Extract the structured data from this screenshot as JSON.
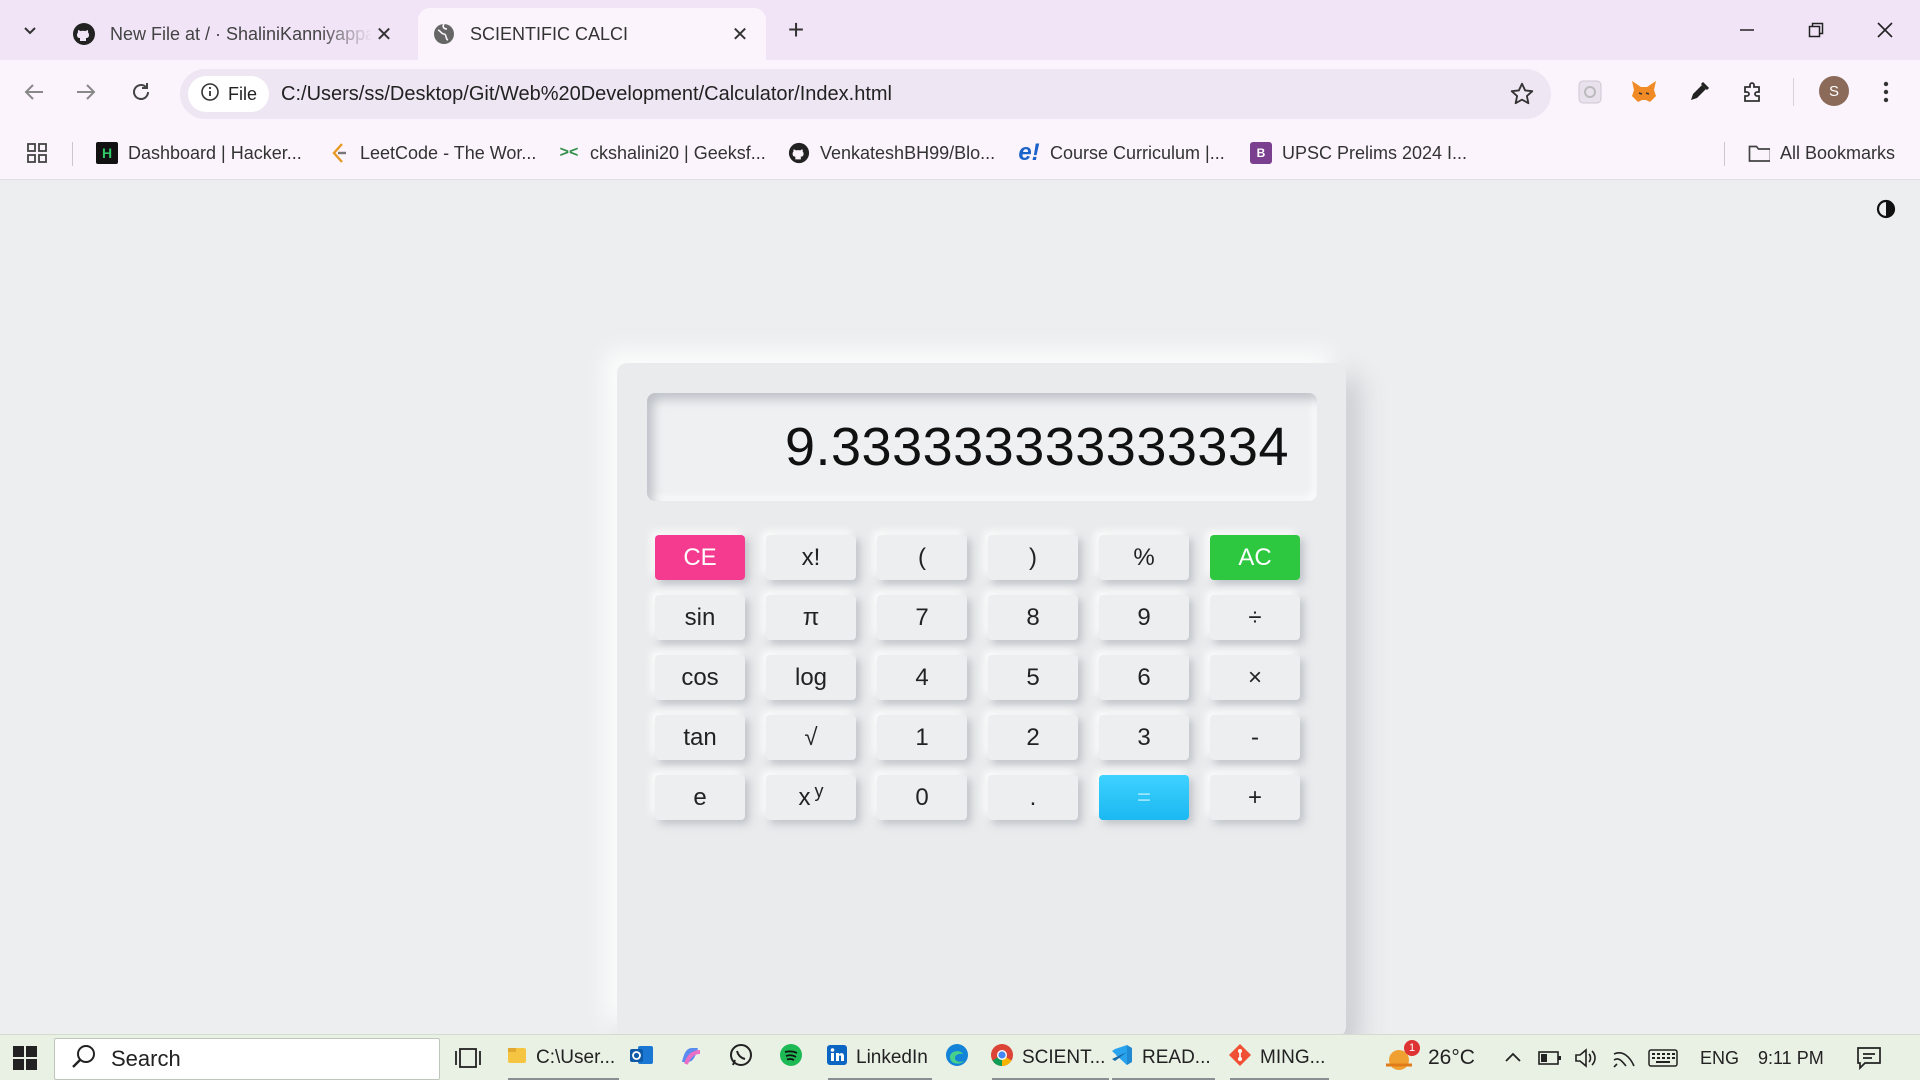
{
  "tabs": [
    {
      "title": "New File at / · ShaliniKanniyappan",
      "favicon": "github-icon"
    },
    {
      "title": "SCIENTIFIC CALCI",
      "favicon": "globe-icon"
    }
  ],
  "omnibox": {
    "chip_label": "File",
    "url": "C:/Users/ss/Desktop/Git/Web%20Development/Calculator/Index.html"
  },
  "avatar_initial": "S",
  "bookmarks": [
    {
      "label": "Dashboard | Hacker...",
      "icon": "hackerrank-icon"
    },
    {
      "label": "LeetCode - The Wor...",
      "icon": "leetcode-icon"
    },
    {
      "label": "ckshalini20 | Geeksf...",
      "icon": "geeksforgeeks-icon"
    },
    {
      "label": "VenkateshBH99/Blo...",
      "icon": "github-icon"
    },
    {
      "label": "Course Curriculum |...",
      "icon": "edureka-icon"
    },
    {
      "label": "UPSC Prelims 2024 I...",
      "icon": "bookmark-book-icon"
    }
  ],
  "all_bookmarks_label": "All Bookmarks",
  "calculator": {
    "display_value": "9.333333333333334",
    "keys": [
      [
        "CE",
        "x!",
        "(",
        ")",
        "%",
        "AC"
      ],
      [
        "sin",
        "π",
        "7",
        "8",
        "9",
        "÷"
      ],
      [
        "cos",
        "log",
        "4",
        "5",
        "6",
        "×"
      ],
      [
        "tan",
        "√",
        "1",
        "2",
        "3",
        "-"
      ],
      [
        "e",
        "x",
        "0",
        ".",
        "=",
        "+"
      ]
    ],
    "power_superscript": "y",
    "colors": {
      "ce": "#f53b8f",
      "ac": "#2dc740",
      "equals": "#1bb8f2"
    }
  },
  "taskbar": {
    "search_placeholder": "Search",
    "items": [
      {
        "label": "C:\\User...",
        "icon": "file-explorer-icon"
      },
      {
        "label": "",
        "icon": "outlook-icon"
      },
      {
        "label": "",
        "icon": "copilot-icon"
      },
      {
        "label": "",
        "icon": "whatsapp-icon"
      },
      {
        "label": "",
        "icon": "spotify-icon"
      },
      {
        "label": "LinkedIn",
        "icon": "linkedin-icon"
      },
      {
        "label": "",
        "icon": "edge-icon"
      },
      {
        "label": "SCIENT...",
        "icon": "chrome-icon"
      },
      {
        "label": "READ...",
        "icon": "vscode-icon"
      },
      {
        "label": "MING...",
        "icon": "git-icon"
      }
    ],
    "weather": {
      "temp": "26°C",
      "badge": "1"
    },
    "language": "ENG",
    "time": "9:11 PM"
  }
}
